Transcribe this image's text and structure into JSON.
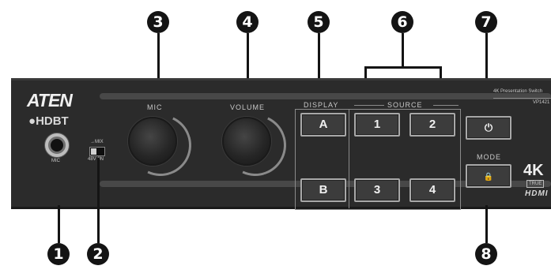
{
  "callouts": {
    "c1": "1",
    "c2": "2",
    "c3": "3",
    "c4": "4",
    "c5": "5",
    "c6": "6",
    "c7": "7",
    "c8": "8"
  },
  "device": {
    "brand": "ATEN",
    "tech_logo": "HDBT",
    "product_name": "4K Presentation Switch",
    "model": "VP1421",
    "hdmi_logo": "HDMI",
    "resolution_badge": "4K",
    "true_label": "TRUE"
  },
  "panel": {
    "mic_jack_label": "MIC",
    "switch_labels": {
      "top": "→MIX",
      "bottom": "48V  0N"
    },
    "mic_knob_label": "MIC",
    "volume_knob_label": "VOLUME",
    "display_group_label": "DISPLAY",
    "source_group_label": "SOURCE",
    "mode_label": "MODE"
  },
  "buttons": {
    "display_a": "A",
    "display_b": "B",
    "source_1": "1",
    "source_2": "2",
    "source_3": "3",
    "source_4": "4",
    "power_icon": "⏻",
    "mode_icon": "🔒"
  },
  "icons": [
    "power-icon",
    "lock-icon",
    "hdbt-logo-icon"
  ],
  "colors": {
    "panel": "#2b2b2b",
    "callout": "#141414",
    "button_border": "#a8a8a8"
  }
}
